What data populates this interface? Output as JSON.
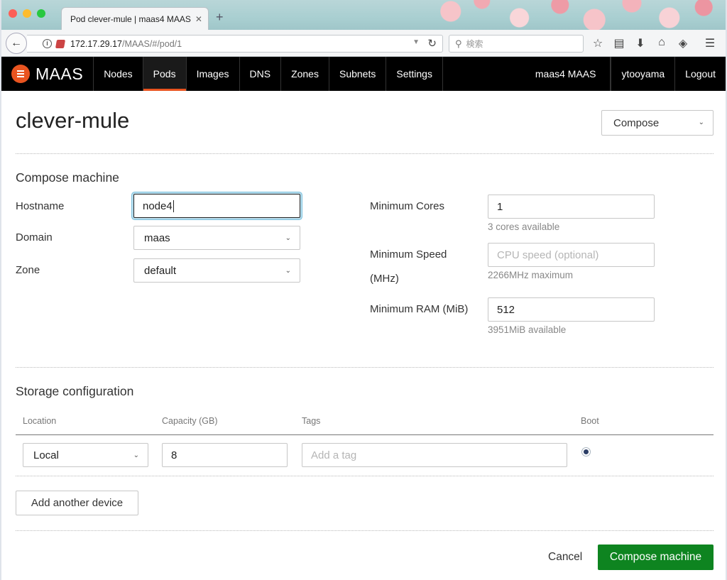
{
  "browser": {
    "tab_title": "Pod clever-mule | maas4 MAAS",
    "tab_close": "✕",
    "new_tab": "+",
    "url_host": "172.17.29.17",
    "url_path": "/MAAS/#/pod/1",
    "search_placeholder": "検索"
  },
  "app_nav": {
    "brand": "MAAS",
    "items": [
      {
        "label": "Nodes"
      },
      {
        "label": "Pods",
        "active": true
      },
      {
        "label": "Images"
      },
      {
        "label": "DNS"
      },
      {
        "label": "Zones"
      },
      {
        "label": "Subnets"
      },
      {
        "label": "Settings"
      }
    ],
    "region": "maas4 MAAS",
    "user": "ytooyama",
    "logout": "Logout",
    "accent_color": "#e95420"
  },
  "page": {
    "title": "clever-mule",
    "compose_dropdown": "Compose"
  },
  "compose": {
    "section_title": "Compose machine",
    "hostname_label": "Hostname",
    "hostname_value": "node4",
    "domain_label": "Domain",
    "domain_value": "maas",
    "zone_label": "Zone",
    "zone_value": "default",
    "cores_label": "Minimum Cores",
    "cores_value": "1",
    "cores_help": "3 cores available",
    "speed_label_line1": "Minimum Speed",
    "speed_label_line2": "(MHz)",
    "speed_placeholder": "CPU speed (optional)",
    "speed_help": "2266MHz maximum",
    "ram_label": "Minimum RAM (MiB)",
    "ram_value": "512",
    "ram_help": "3951MiB available"
  },
  "storage": {
    "section_title": "Storage configuration",
    "columns": [
      "Location",
      "Capacity (GB)",
      "Tags",
      "Boot"
    ],
    "row": {
      "location": "Local",
      "capacity": "8",
      "tags_placeholder": "Add a tag",
      "boot_selected": true
    },
    "add_device": "Add another device"
  },
  "actions": {
    "cancel": "Cancel",
    "compose": "Compose machine",
    "primary_color": "#0e8420"
  }
}
